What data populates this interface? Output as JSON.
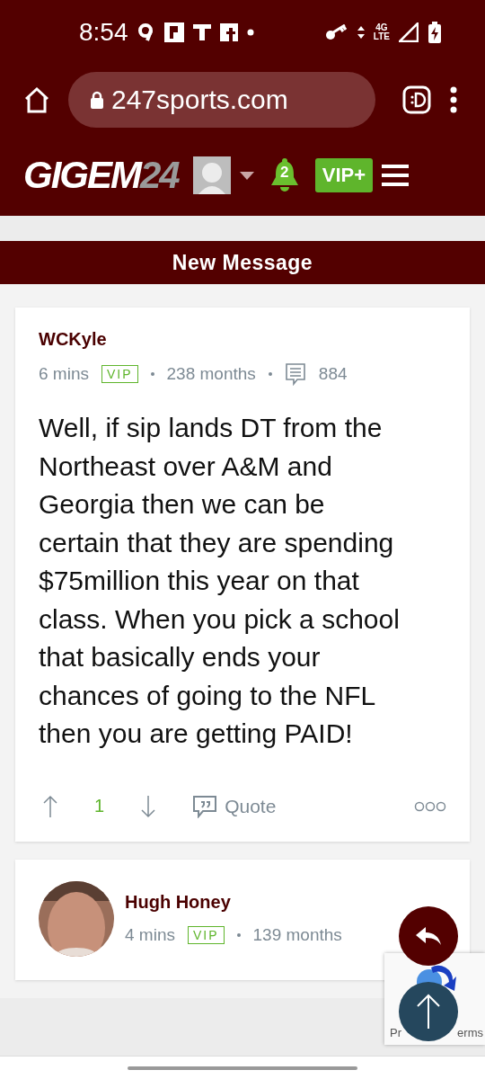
{
  "status_bar": {
    "time": "8:54",
    "network": "4G LTE"
  },
  "browser": {
    "url": "247sports.com"
  },
  "site_header": {
    "logo": "GIGEM",
    "logo_suffix": "24",
    "notifications": "2",
    "vip_button": "VIP+"
  },
  "section_title": "New Message",
  "posts": [
    {
      "author": "WCKyle",
      "time": "6 mins",
      "badge": "VIP",
      "tenure": "238 months",
      "post_count": "884",
      "avatar": false,
      "body": "Well, if sip lands DT from the Northeast over A&M and Georgia then we can be certain that they are spending $75million this year on that class. When you pick a school that basically ends your chances of going to the NFL then you are getting PAID!",
      "votes": "1",
      "quote": "Quote"
    },
    {
      "author": "Hugh Honey",
      "time": "4 mins",
      "badge": "VIP",
      "tenure": "139 months",
      "avatar": true
    }
  ],
  "recaptcha": {
    "left_text": "Pr",
    "right_text": "erms"
  }
}
